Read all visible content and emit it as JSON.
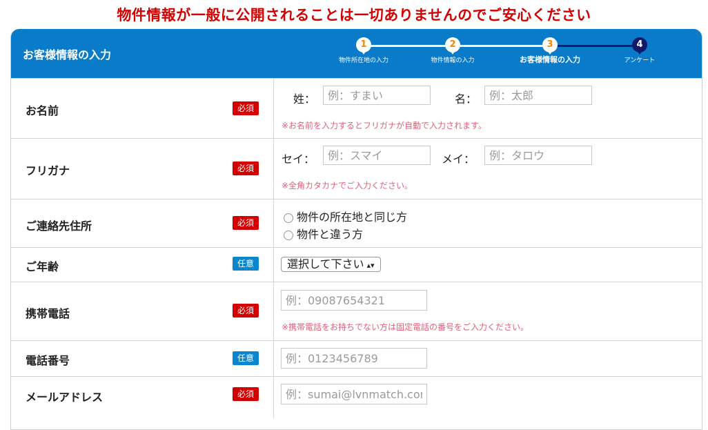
{
  "notice": "物件情報が一般に公開されることは一切ありませんのでご安心ください",
  "header": {
    "title": "お客様情報の入力",
    "steps": [
      {
        "number": "1",
        "label": "物件所在地の入力"
      },
      {
        "number": "2",
        "label": "物件情報の入力"
      },
      {
        "number": "3",
        "label": "お客様情報の入力"
      },
      {
        "number": "4",
        "label": "アンケート"
      }
    ]
  },
  "badges": {
    "required": "必須",
    "optional": "任意"
  },
  "rows": {
    "name": {
      "label": "お名前",
      "last_label": "姓：",
      "last_placeholder": "例：すまい",
      "first_label": "名：",
      "first_placeholder": "例：太郎",
      "hint": "※お名前を入力するとフリガナが自動で入力されます。"
    },
    "furigana": {
      "label": "フリガナ",
      "last_label": "セイ：",
      "last_placeholder": "例：スマイ",
      "first_label": "メイ：",
      "first_placeholder": "例：タロウ",
      "hint": "※全角カタカナでご入力ください。"
    },
    "address": {
      "label": "ご連絡先住所",
      "option_same": "物件の所在地と同じ方",
      "option_different": "物件と違う方"
    },
    "age": {
      "label": "ご年齢",
      "select_value": "選択して下さい"
    },
    "mobile": {
      "label": "携帯電話",
      "placeholder": "例：09087654321",
      "hint": "※携帯電話をお持ちでない方は固定電話の番号をご入力ください。"
    },
    "phone": {
      "label": "電話番号",
      "placeholder": "例：0123456789"
    },
    "email": {
      "label": "メールアドレス",
      "placeholder": "例：sumai@lvnmatch.com"
    }
  }
}
